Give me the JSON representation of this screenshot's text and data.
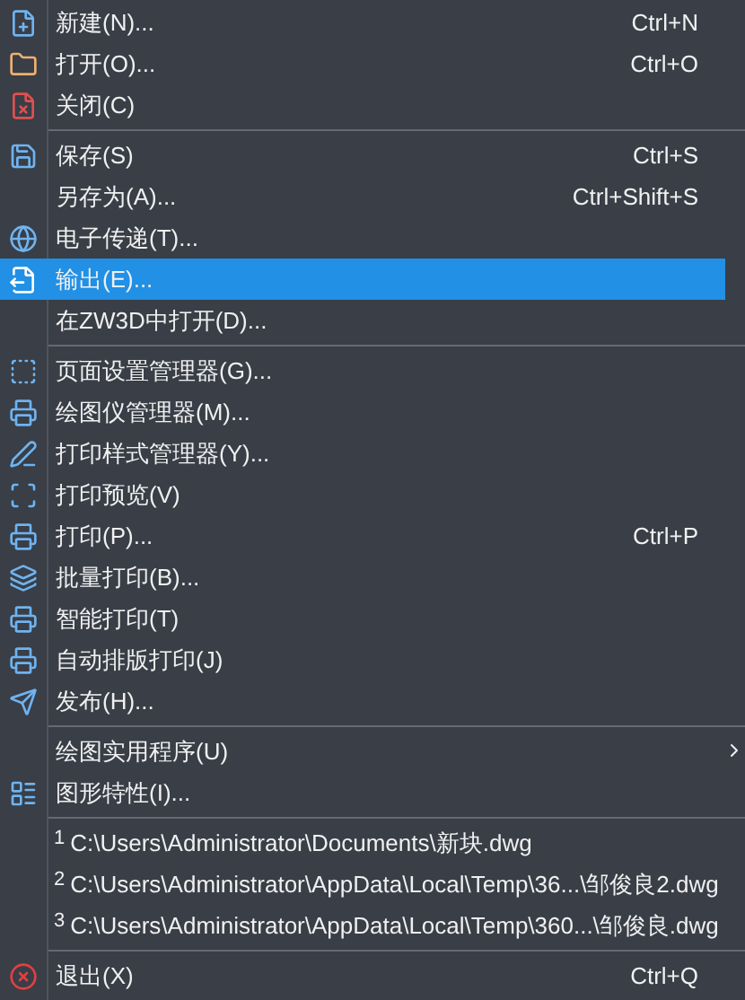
{
  "menu": {
    "sections": [
      {
        "items": [
          {
            "kind": "command",
            "label": "新建(N)...",
            "shortcut": "Ctrl+N",
            "selected": false
          },
          {
            "kind": "command",
            "label": "打开(O)...",
            "shortcut": "Ctrl+O",
            "selected": false
          },
          {
            "kind": "command",
            "label": "关闭(C)",
            "selected": false
          }
        ]
      },
      {
        "items": [
          {
            "kind": "command",
            "label": "保存(S)",
            "shortcut": "Ctrl+S",
            "selected": false
          },
          {
            "kind": "command",
            "label": "另存为(A)...",
            "shortcut": "Ctrl+Shift+S",
            "selected": false
          },
          {
            "kind": "command",
            "label": "电子传递(T)...",
            "selected": false
          },
          {
            "kind": "command",
            "label": "输出(E)...",
            "selected": true
          },
          {
            "kind": "command",
            "label": "在ZW3D中打开(D)...",
            "selected": false
          }
        ]
      },
      {
        "items": [
          {
            "kind": "command",
            "label": "页面设置管理器(G)...",
            "selected": false
          },
          {
            "kind": "command",
            "label": "绘图仪管理器(M)...",
            "selected": false
          },
          {
            "kind": "command",
            "label": "打印样式管理器(Y)...",
            "selected": false
          },
          {
            "kind": "command",
            "label": "打印预览(V)",
            "selected": false
          },
          {
            "kind": "command",
            "label": "打印(P)...",
            "shortcut": "Ctrl+P",
            "selected": false
          },
          {
            "kind": "command",
            "label": "批量打印(B)...",
            "selected": false
          },
          {
            "kind": "command",
            "label": "智能打印(T)",
            "selected": false
          },
          {
            "kind": "command",
            "label": "自动排版打印(J)",
            "selected": false
          },
          {
            "kind": "command",
            "label": "发布(H)...",
            "selected": false
          }
        ]
      },
      {
        "items": [
          {
            "kind": "submenu",
            "label": "绘图实用程序(U)",
            "selected": false
          },
          {
            "kind": "command",
            "label": "图形特性(I)...",
            "selected": false
          }
        ]
      },
      {
        "items": [
          {
            "kind": "recent",
            "number": "1",
            "label": "C:\\Users\\Administrator\\Documents\\新块.dwg",
            "selected": false
          },
          {
            "kind": "recent",
            "number": "2",
            "label": "C:\\Users\\Administrator\\AppData\\Local\\Temp\\36...\\邹俊良2.dwg",
            "selected": false
          },
          {
            "kind": "recent",
            "number": "3",
            "label": "C:\\Users\\Administrator\\AppData\\Local\\Temp\\360...\\邹俊良.dwg",
            "selected": false
          }
        ]
      },
      {
        "items": [
          {
            "kind": "command",
            "label": "退出(X)",
            "shortcut": "Ctrl+Q",
            "selected": false
          }
        ]
      }
    ]
  }
}
